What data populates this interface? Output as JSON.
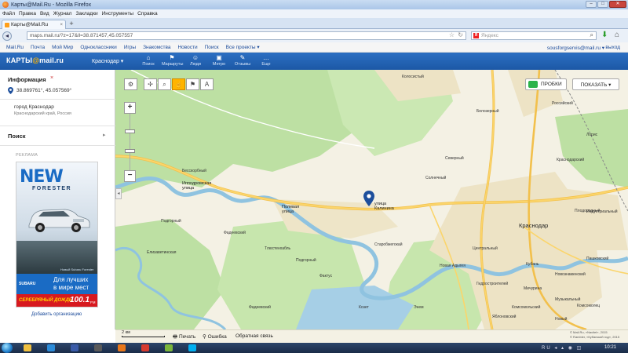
{
  "window": {
    "title": "Карты@Mail.Ru - Mozilla Firefox"
  },
  "menu": [
    "Файл",
    "Правка",
    "Вид",
    "Журнал",
    "Закладки",
    "Инструменты",
    "Справка"
  ],
  "tab": {
    "label": "Карты@Mail.Ru"
  },
  "address_bar": {
    "url": "maps.mail.ru/?z=17&ll=38.871457,45.057557"
  },
  "search_bar": {
    "placeholder": "Яндекс"
  },
  "site_links": {
    "items": [
      "Mail.Ru",
      "Почта",
      "Мой Мир",
      "Одноклассники",
      "Игры",
      "Знакомства",
      "Новости",
      "Поиск",
      "Все проекты ▾"
    ],
    "user": "sousforgservis@mail.ru ▾",
    "logout": "выход"
  },
  "maps_header": {
    "logo_text": "КАРТЫ",
    "logo_at": "@",
    "logo_domain": "mail.ru",
    "city": "Краснодар ▾",
    "nav": [
      {
        "icon": "⌂",
        "label": "Поиск"
      },
      {
        "icon": "⚑",
        "label": "Маршруты"
      },
      {
        "icon": "☺",
        "label": "Люди"
      },
      {
        "icon": "▣",
        "label": "Метро"
      },
      {
        "icon": "✎",
        "label": "Отзывы"
      },
      {
        "icon": "…",
        "label": "Еще"
      }
    ]
  },
  "left_panel": {
    "info_title": "Информация",
    "info_close": "×",
    "coords": "38.869761°, 45.057569°",
    "city": "город Краснодар",
    "region": "Краснодарский край, Россия",
    "search_title": "Поиск",
    "search_arrow": "▸",
    "ad_label": "РЕКЛАМА",
    "ad": {
      "new": "NEW",
      "model": "FORESTER",
      "sub": "Новый Subaru Forester",
      "brand": "SUBARU",
      "slogan_line1": "Для лучших",
      "slogan_line2": "в мире мест",
      "radio": "СЕРЕБРЯНЫЙ ДОЖДЬ",
      "frequency": "100.1",
      "fm": "FM"
    },
    "add_org": "Добавить организацию"
  },
  "map": {
    "labels": [
      {
        "text": "Колосистый",
        "cls": "maplabel"
      },
      {
        "text": "Бесскорбный",
        "cls": "maplabel"
      },
      {
        "text": "Российский",
        "cls": "maplabel"
      },
      {
        "text": "Краснодарский",
        "cls": "maplabel"
      },
      {
        "text": "Лорис",
        "cls": "maplabel"
      },
      {
        "text": "Белозерный",
        "cls": "maplabel"
      },
      {
        "text": "Подгорный",
        "cls": "maplabel"
      },
      {
        "text": "Фадеевский",
        "cls": "maplabel"
      },
      {
        "text": "Солнечный",
        "cls": "maplabel"
      },
      {
        "text": "Северный",
        "cls": "maplabel"
      },
      {
        "text": "Фадеевский",
        "cls": "maplabel"
      },
      {
        "text": "Центральный",
        "cls": "maplabel"
      },
      {
        "text": "Индустриальный",
        "cls": "maplabel"
      },
      {
        "text": "Колосистый",
        "cls": "maplabel"
      },
      {
        "text": "Плодородный",
        "cls": "maplabel"
      },
      {
        "text": "Пашковский",
        "cls": "maplabel"
      },
      {
        "text": "Новознаменский",
        "cls": "maplabel"
      },
      {
        "text": "Гидростроителей",
        "cls": "maplabel"
      },
      {
        "text": "Музыкальный",
        "cls": "maplabel"
      },
      {
        "text": "Комсомольский",
        "cls": "maplabel"
      },
      {
        "text": "Елизаветинская",
        "cls": "maplabel"
      },
      {
        "text": "Подгорный",
        "cls": "maplabel"
      },
      {
        "text": "Фактус",
        "cls": "maplabel"
      },
      {
        "text": "Тлюстенхабль",
        "cls": "maplabel"
      },
      {
        "text": "Старобжегокай",
        "cls": "maplabel"
      },
      {
        "text": "Новая Адыгея",
        "cls": "maplabel"
      },
      {
        "text": "Козет",
        "cls": "maplabel"
      },
      {
        "text": "Энем",
        "cls": "maplabel"
      },
      {
        "text": "Яблоновский",
        "cls": "maplabel"
      },
      {
        "text": "Новый",
        "cls": "maplabel"
      },
      {
        "text": "Кубань",
        "cls": "maplabel"
      },
      {
        "text": "Мичурина",
        "cls": "maplabel"
      },
      {
        "text": "Комсомолец",
        "cls": "maplabel"
      },
      {
        "text": "Краснодар",
        "cls": "maplabel big"
      },
      {
        "text": "улица\nКалинина",
        "cls": "maplabel street"
      },
      {
        "text": "Полевая\nулица",
        "cls": "maplabel street"
      },
      {
        "text": "Ипподромская\nулица",
        "cls": "maplabel street"
      }
    ],
    "tools": [
      "✢",
      "⌕",
      "☝",
      "⚑",
      "A"
    ],
    "zoom_in": "+",
    "zoom_out": "−",
    "traffic": "ПРОБКИ",
    "show": "ПОКАЗАТЬ ▾",
    "scale": "2 км",
    "collapse": "◂",
    "print": "🖶 Печать",
    "error": "⚲ Ошибка",
    "feedback": "Обратная связь",
    "copyright1": "© Mail.Ru, «Navitel», 2015",
    "copyright2": "© Rambler, «Кубанский гид», 2015"
  },
  "taskbar": {
    "time": "10:21",
    "tray": "RU ◂ ▴ ◉ ◫"
  },
  "colors": {
    "header_blue": "#1c58a6",
    "map_forest": "#bde0a3",
    "map_water": "#a6cfe6",
    "map_road": "#fbd56b",
    "marker": "#1d4f9c",
    "accent_orange": "#ffb400"
  }
}
